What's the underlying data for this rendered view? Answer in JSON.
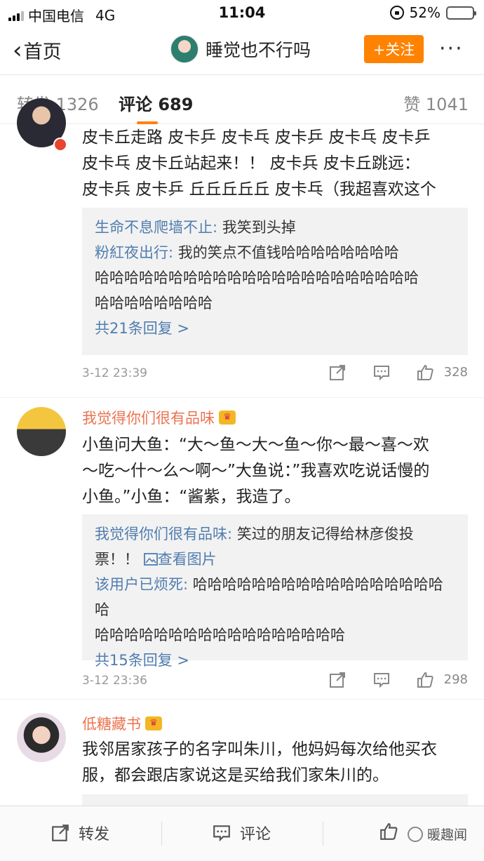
{
  "status_bar": {
    "carrier": "中国电信",
    "network": "4G",
    "time": "11:04",
    "battery_percent": "52%",
    "battery_level": 0.52
  },
  "nav": {
    "back_label": "首页",
    "title": "睡觉也不行吗",
    "follow_label": "+关注",
    "more_label": "···"
  },
  "tabs": [
    {
      "label": "转发 1326",
      "active": false
    },
    {
      "label": "评论 689",
      "active": true
    },
    {
      "label": "赞 1041",
      "active": false
    }
  ],
  "comments": [
    {
      "text_lines": [
        "皮卡丘走路 皮卡乒 皮卡乓 皮卡乒 皮卡乓 皮卡乒",
        "皮卡乓 皮卡丘站起来！！ 皮卡兵 皮卡丘跳远：",
        "皮卡兵 皮卡乒 丘丘丘丘丘 皮卡乓（我超喜欢这个"
      ],
      "replies": [
        {
          "name": "生命不息爬墙不止",
          "lines": [
            "我笑到头掉"
          ]
        },
        {
          "name": "粉紅夜出行",
          "lines": [
            "我的笑点不值钱哈哈哈哈哈哈哈哈",
            "哈哈哈哈哈哈哈哈哈哈哈哈哈哈哈哈哈哈哈哈哈哈",
            "哈哈哈哈哈哈哈哈"
          ]
        }
      ],
      "more_replies": "共21条回复 >",
      "time": "3-12 23:39",
      "likes": "328"
    },
    {
      "name": "我觉得你们很有品味",
      "text_lines": [
        "小鱼问大鱼：“大～鱼～大～鱼～你～最～喜～欢",
        "～吃～什～么～啊～”大鱼说：”我喜欢吃说话慢的",
        "小鱼。”小鱼：“酱紫，我造了。"
      ],
      "replies": [
        {
          "name": "我觉得你们很有品味",
          "lines": [
            "笑过的朋友记得给林彦俊投",
            "票！！"
          ],
          "image_link": "查看图片"
        },
        {
          "name": "该用户已烦死",
          "lines": [
            "哈哈哈哈哈哈哈哈哈哈哈哈哈哈哈哈哈哈",
            "哈哈哈哈哈哈哈哈哈哈哈哈哈哈哈哈哈"
          ]
        }
      ],
      "more_replies": "共15条回复 >",
      "time": "3-12 23:36",
      "likes": "298"
    },
    {
      "name": "低糖藏书",
      "text_lines": [
        "我邻居家孩子的名字叫朱川，他妈妈每次给他买衣",
        "服，都会跟店家说这是买给我们家朱川的。"
      ]
    }
  ],
  "toolbar": {
    "repost_label": "转发",
    "comment_label": "评论",
    "watermark": "暖趣闻"
  },
  "colors": {
    "accent": "#ff8200",
    "username": "#eb7350",
    "link": "#507daf"
  }
}
